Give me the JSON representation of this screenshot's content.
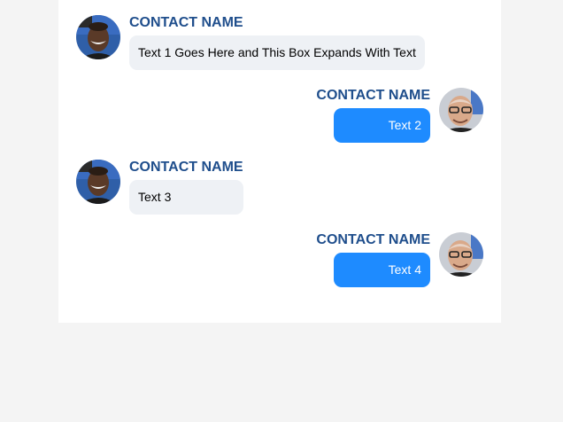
{
  "colors": {
    "page_background": "#f4f4f4",
    "panel_background": "#ffffff",
    "contact_name": "#1f4e8c",
    "incoming_bubble": "#eef1f5",
    "outgoing_bubble": "#1e8bff"
  },
  "messages": [
    {
      "direction": "incoming",
      "contact_name": "CONTACT NAME",
      "text": "Text 1 Goes Here and This Box Expands With Text",
      "avatar": "contact-a-avatar"
    },
    {
      "direction": "outgoing",
      "contact_name": "CONTACT NAME",
      "text": "Text 2",
      "avatar": "contact-b-avatar"
    },
    {
      "direction": "incoming",
      "contact_name": "CONTACT NAME",
      "text": "Text 3",
      "avatar": "contact-a-avatar"
    },
    {
      "direction": "outgoing",
      "contact_name": "CONTACT NAME",
      "text": "Text 4",
      "avatar": "contact-b-avatar"
    }
  ]
}
